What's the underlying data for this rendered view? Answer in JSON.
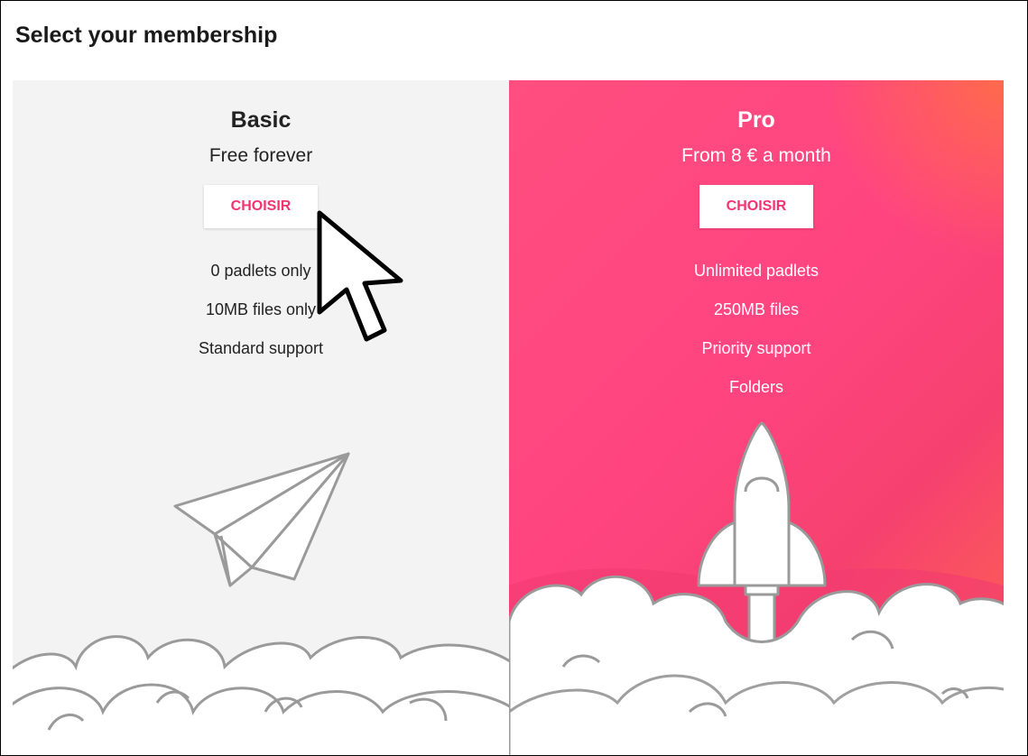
{
  "page": {
    "title": "Select your membership"
  },
  "plans": [
    {
      "name": "Basic",
      "price": "Free forever",
      "button_label": "CHOISIR",
      "features": [
        "0 padlets only",
        "10MB files only",
        "Standard support"
      ]
    },
    {
      "name": "Pro",
      "price": "From 8 € a month",
      "button_label": "CHOISIR",
      "features": [
        "Unlimited padlets",
        "250MB files",
        "Priority support",
        "Folders"
      ]
    }
  ],
  "colors": {
    "accent": "#f3326f",
    "pro_gradient_start": "#ff4e7f",
    "pro_gradient_end": "#ff6a4a",
    "basic_background": "#f3f3f3"
  },
  "icons": {
    "basic_illustration": "paper-plane-icon",
    "pro_illustration": "rocket-icon",
    "pointer": "mouse-cursor-icon"
  }
}
